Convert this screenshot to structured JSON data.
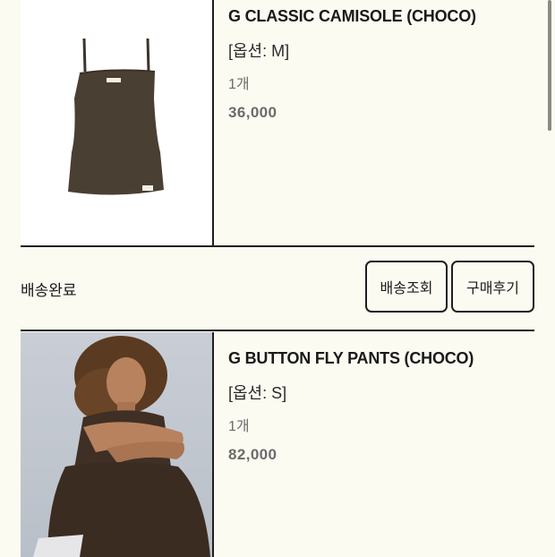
{
  "items": [
    {
      "title": "G CLASSIC CAMISOLE (CHOCO)",
      "option": "[옵션: M]",
      "qty": "1개",
      "price": "36,000",
      "image_icon": "camisole-product-image"
    },
    {
      "title": "G BUTTON FLY PANTS (CHOCO)",
      "option": "[옵션: S]",
      "qty": "1개",
      "price": "82,000",
      "image_icon": "model-wearing-pants-photo"
    }
  ],
  "status": {
    "label": "배송완료",
    "track_button": "배송조회",
    "review_button": "구매후기"
  },
  "colors": {
    "background": "#fbfbf1",
    "product_color": "#4a3f33",
    "border": "#1f1f1f"
  }
}
